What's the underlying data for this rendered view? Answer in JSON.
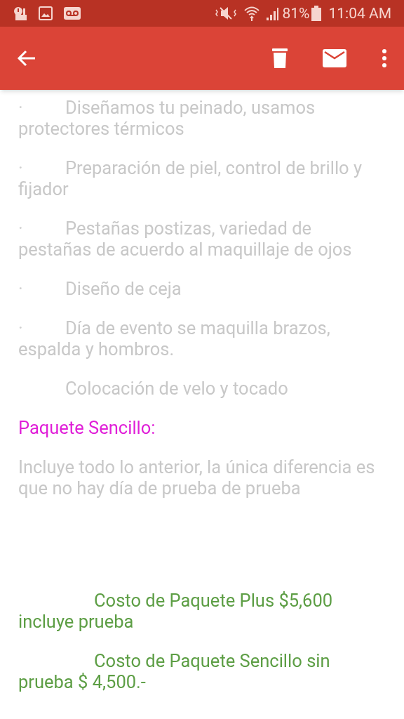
{
  "status_bar": {
    "battery": "81%",
    "time": "11:04 AM"
  },
  "paragraphs": [
    {
      "kind": "bullet",
      "bullet": "·",
      "text": "Diseñamos tu  peinado, usamos protectores térmicos"
    },
    {
      "kind": "bullet",
      "bullet": "·",
      "text": "Preparación de piel,  control de brillo y fijador"
    },
    {
      "kind": "bullet",
      "bullet": "·",
      "text": "Pestañas postizas, variedad de pestañas de acuerdo al maquillaje de ojos"
    },
    {
      "kind": "bullet",
      "bullet": "·",
      "text": "Diseño de ceja"
    },
    {
      "kind": "bullet",
      "bullet": "·",
      "text": "Día de evento se maquilla brazos, espalda y hombros."
    },
    {
      "kind": "indent",
      "text": "Colocación de velo y tocado"
    },
    {
      "kind": "heading",
      "text": "Paquete Sencillo:"
    },
    {
      "kind": "body",
      "text": "Incluye todo lo anterior, la única diferencia es que no hay día de prueba de prueba"
    },
    {
      "kind": "price",
      "text": "Costo de Paquete Plus  $5,600 incluye prueba"
    },
    {
      "kind": "price",
      "text": "Costo de Paquete Sencillo sin prueba $ 4,500.-"
    }
  ]
}
